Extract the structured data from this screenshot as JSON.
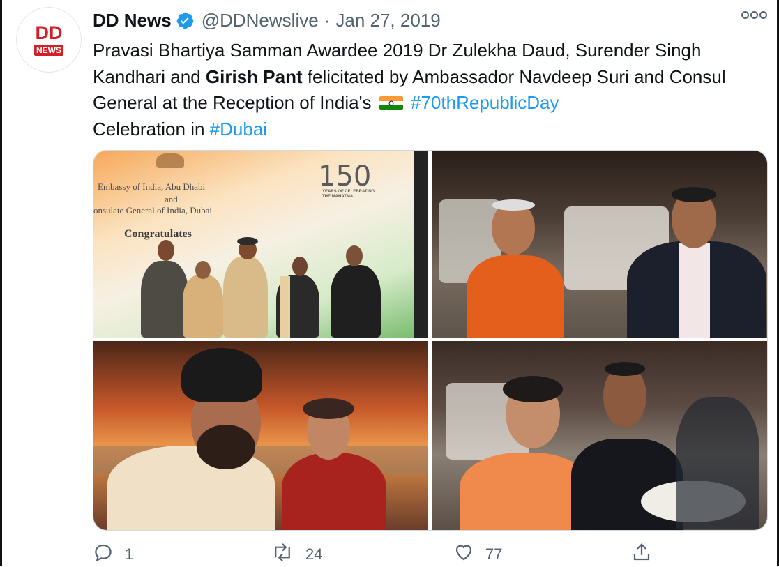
{
  "tweet": {
    "display_name": "DD News",
    "handle": "@DDNewslive",
    "separator": "·",
    "date": "Jan 27, 2019",
    "avatar": {
      "top_text": "DD",
      "bottom_text": "NEWS",
      "brand_color": "#d51f26"
    },
    "text": {
      "part1": "Pravasi Bhartiya Samman Awardee 2019 Dr Zulekha Daud, Surender Singh Kandhari and ",
      "bold": "Girish Pant",
      "part2": " felicitated by Ambassador Navdeep Suri and Consul General at the Reception of India's",
      "hashtag1": "#70thRepublicDay",
      "part3": "Celebration in ",
      "hashtag2": "#Dubai"
    },
    "flag_icon": "india-flag-emoji",
    "photos": {
      "photo1": {
        "line1": "Embassy of India, Abu Dhabi",
        "line2": "and",
        "line3": "onsulate General of India, Dubai",
        "line4": "Congratulates",
        "logo_number": "150",
        "logo_sub": "YEARS OF CELEBRATING THE MAHATMA"
      }
    },
    "actions": {
      "reply_count": "1",
      "retweet_count": "24",
      "like_count": "77"
    },
    "colors": {
      "link": "#1d9bf0",
      "muted": "#536471",
      "verified": "#1d9bf0"
    }
  }
}
